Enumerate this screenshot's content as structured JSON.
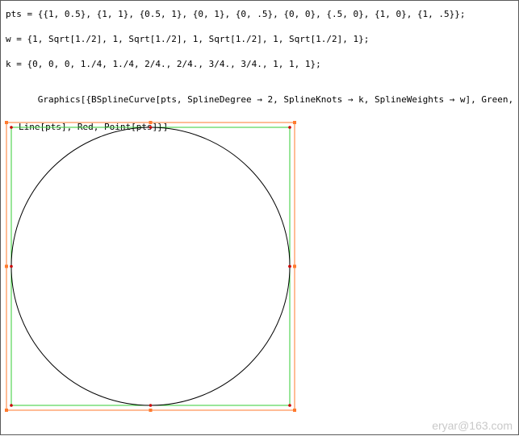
{
  "cells": [
    {
      "id": "pts",
      "text": "pts = {{1, 0.5}, {1, 1}, {0.5, 1}, {0, 1}, {0, .5}, {0, 0}, {.5, 0}, {1, 0}, {1, .5}};"
    },
    {
      "id": "w",
      "text": "w = {1, Sqrt[1./2], 1, Sqrt[1./2], 1, Sqrt[1./2], 1, Sqrt[1./2], 1};"
    },
    {
      "id": "k",
      "text": "k = {0, 0, 0, 1./4, 1./4, 2/4., 2/4., 3/4., 3/4., 1, 1, 1};"
    },
    {
      "id": "graphics",
      "line1": "Graphics[{BSplineCurve[pts, SplineDegree → 2, SplineKnots → k, SplineWeights → w], Green,",
      "line2": "Line[pts], Red, Point[pts]}]"
    }
  ],
  "plot": {
    "control_points": [
      [
        1,
        0.5
      ],
      [
        1,
        1
      ],
      [
        0.5,
        1
      ],
      [
        0,
        1
      ],
      [
        0,
        0.5
      ],
      [
        0,
        0
      ],
      [
        0.5,
        0
      ],
      [
        1,
        0
      ],
      [
        1,
        0.5
      ]
    ],
    "colors": {
      "curve": "#000000",
      "polyline": "#33cc33",
      "points": "#cc0000",
      "selection": "#ff7a2e"
    }
  },
  "watermark": "eryar@163.com"
}
